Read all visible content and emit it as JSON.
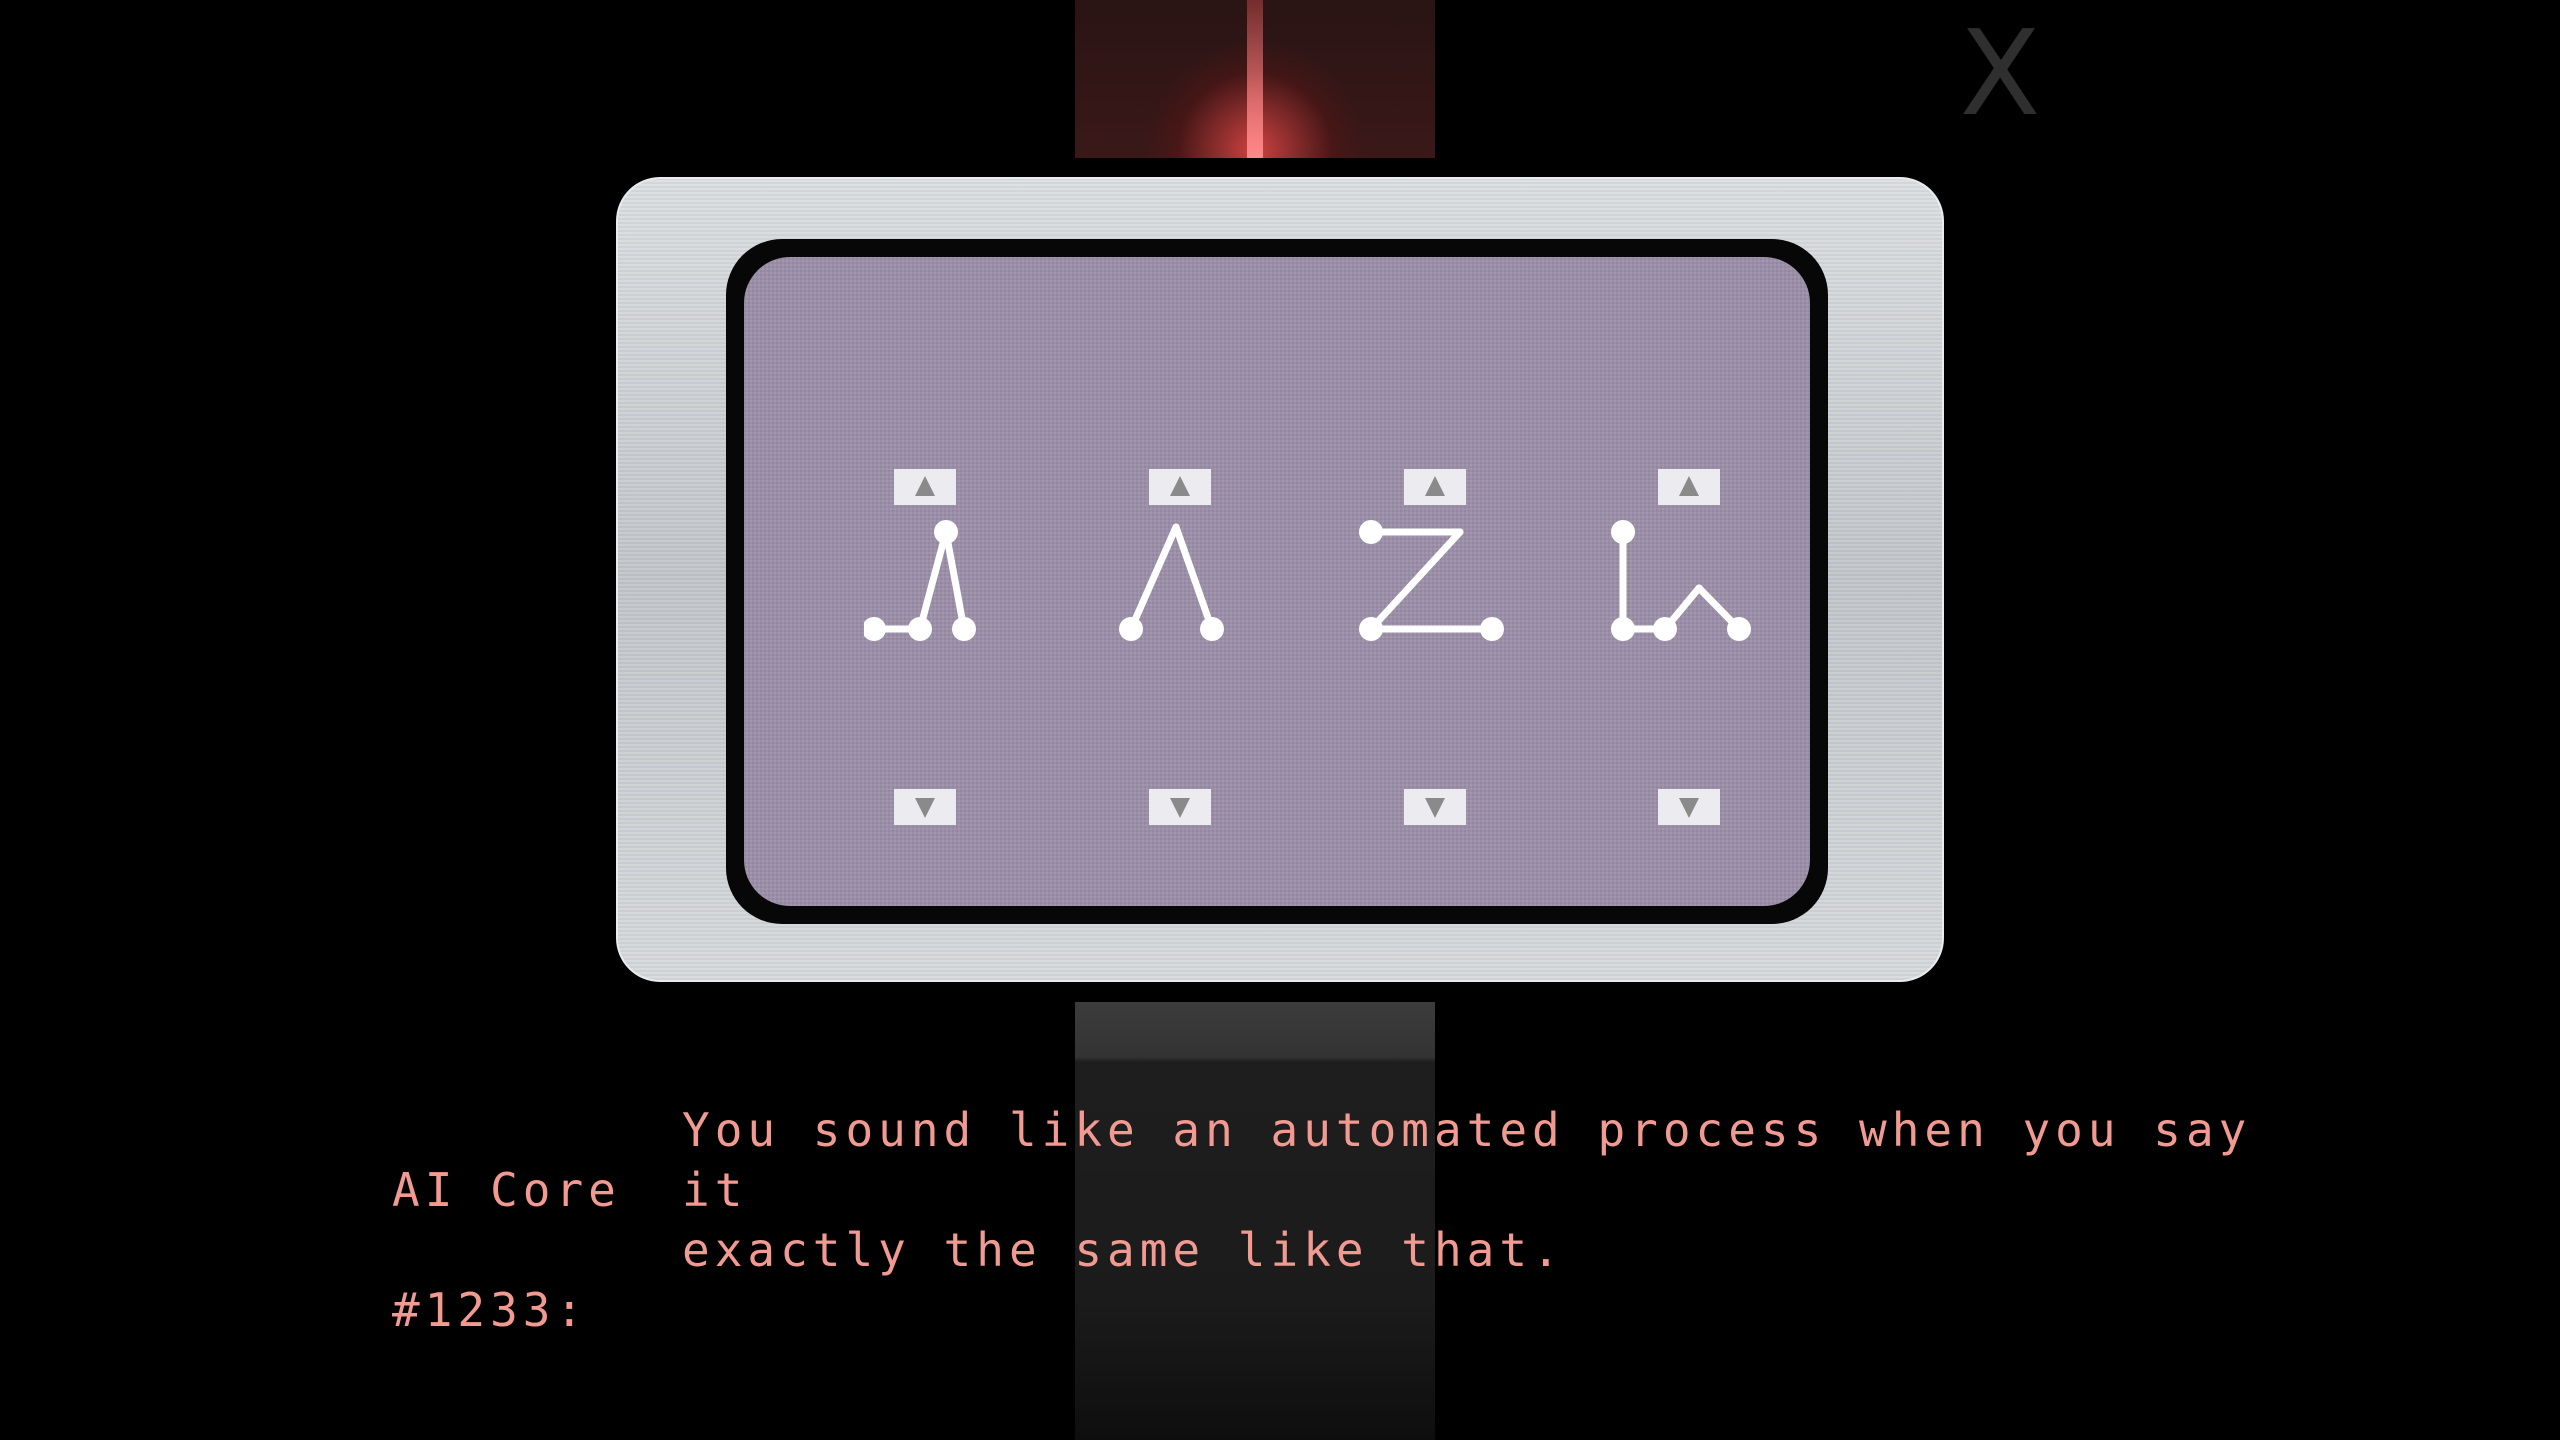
{
  "close_button": {
    "label": "X"
  },
  "puzzle": {
    "glyph_icons": [
      "glyph-1-icon",
      "glyph-2-icon",
      "glyph-3-icon",
      "glyph-4-icon"
    ],
    "up_icon": "triangle-up",
    "down_icon": "triangle-down"
  },
  "dialogue": {
    "speaker_line1": "AI Core",
    "speaker_line2": "#1233:",
    "text_line1": "You sound like an automated process when you say it",
    "text_line2": "exactly the same like that."
  },
  "colors": {
    "dialogue_text": "#f19a92",
    "screen": "#9c93a9",
    "glyph": "#ffffff",
    "top_light": "#ff5050"
  }
}
